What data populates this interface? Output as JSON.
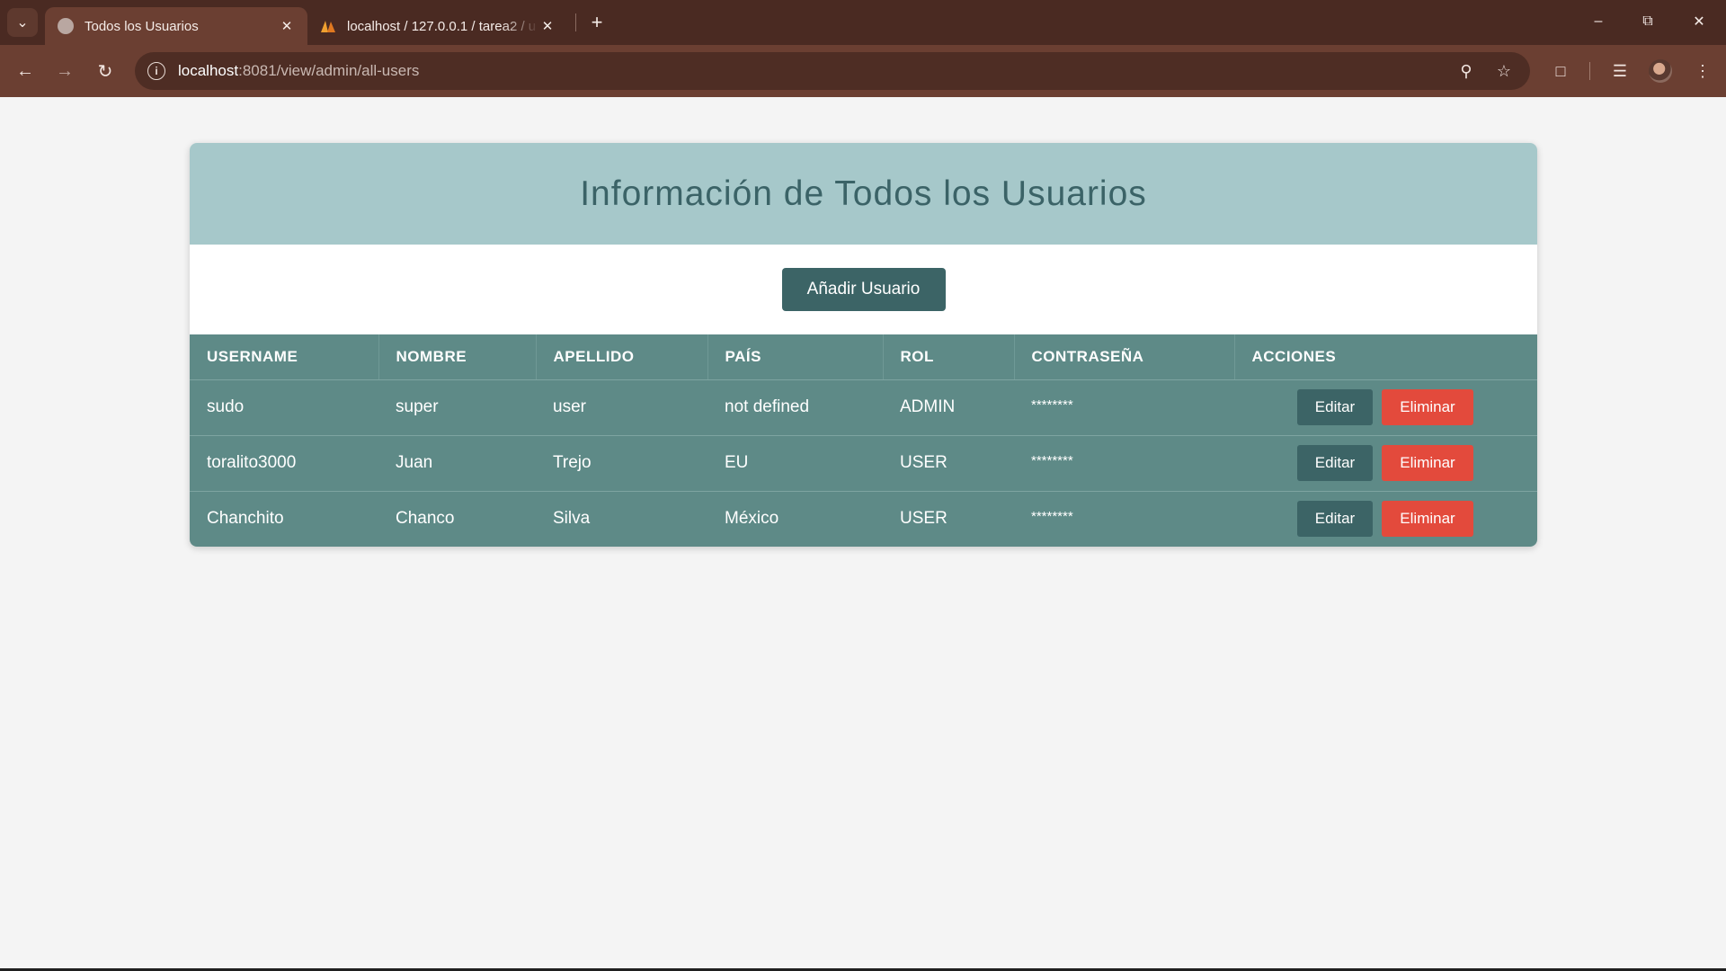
{
  "browser": {
    "tabs": [
      {
        "title": "Todos los Usuarios",
        "icon": "globe-icon",
        "active": true
      },
      {
        "title": "localhost / 127.0.0.1 / tarea2 / u",
        "icon": "phpmyadmin-icon",
        "active": false
      }
    ],
    "address": {
      "host": "localhost",
      "path": ":8081/view/admin/all-users"
    }
  },
  "page": {
    "title": "Información de Todos los Usuarios",
    "add_button": "Añadir Usuario",
    "table": {
      "headers": [
        "USERNAME",
        "NOMBRE",
        "APELLIDO",
        "PAÍS",
        "ROL",
        "CONTRASEÑA",
        "ACCIONES"
      ],
      "rows": [
        {
          "username": "sudo",
          "nombre": "super",
          "apellido": "user",
          "pais": "not defined",
          "rol": "ADMIN",
          "password": "********"
        },
        {
          "username": "toralito3000",
          "nombre": "Juan",
          "apellido": "Trejo",
          "pais": "EU",
          "rol": "USER",
          "password": "********"
        },
        {
          "username": "Chanchito",
          "nombre": "Chanco",
          "apellido": "Silva",
          "pais": "México",
          "rol": "USER",
          "password": "********"
        }
      ],
      "edit_label": "Editar",
      "delete_label": "Eliminar"
    }
  },
  "colors": {
    "header_bg": "#a6c8ca",
    "table_bg": "#5e8a87",
    "primary_button": "#3c6466",
    "danger_button": "#e34a3c"
  }
}
